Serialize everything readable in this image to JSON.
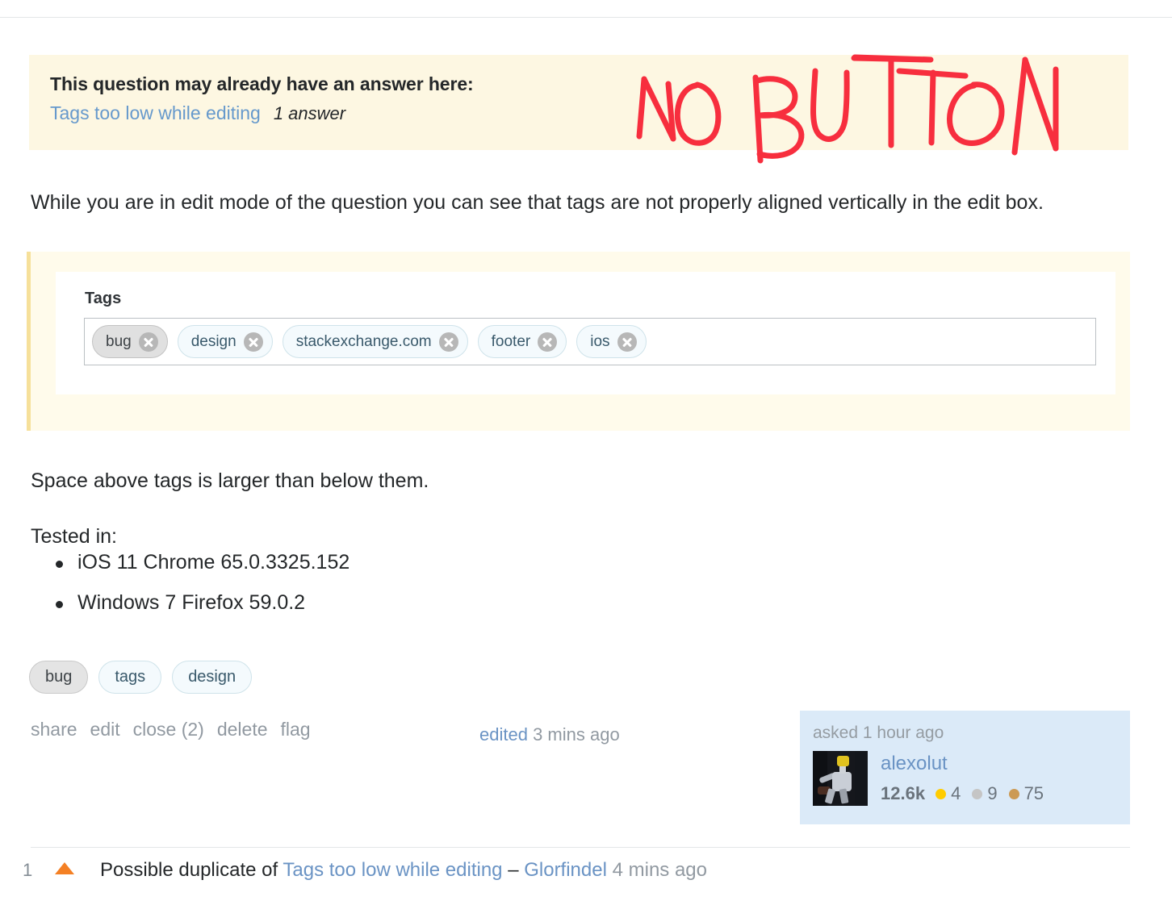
{
  "duplicate_banner": {
    "title": "This question may already have an answer here:",
    "link_text": "Tags too low while editing",
    "answer_count": "1 answer",
    "background": "#fdf7e2",
    "link_color": "#6699cc"
  },
  "annotation": {
    "text": "NO BUTTON",
    "color": "#f72e3e",
    "style": "handwritten-marker"
  },
  "post_body": {
    "intro": "While you are in edit mode of the question you can see that tags are not properly aligned vertically in the edit box.",
    "after_quote": "Space above tags is larger than below them.",
    "tested_label": "Tested in:",
    "tested_items": [
      "iOS 11 Chrome 65.0.3325.152",
      "Windows 7 Firefox 59.0.2"
    ]
  },
  "screenshot_quote": {
    "tags_label": "Tags",
    "editor_tags": [
      {
        "name": "bug",
        "focused": true
      },
      {
        "name": "design",
        "focused": false
      },
      {
        "name": "stackexchange.com",
        "focused": false
      },
      {
        "name": "footer",
        "focused": false
      },
      {
        "name": "ios",
        "focused": false
      }
    ],
    "remove_icon": "close-circle-icon",
    "border_color": "#f6e09a",
    "background": "#fffbeb"
  },
  "post_tags": [
    {
      "label": "bug",
      "selected": true
    },
    {
      "label": "tags",
      "selected": false
    },
    {
      "label": "design",
      "selected": false
    }
  ],
  "post_actions": [
    "share",
    "edit",
    "close (2)",
    "delete",
    "flag"
  ],
  "edited_stamp": {
    "link": "edited",
    "time": "3 mins ago"
  },
  "user_card": {
    "action_time": "asked 1 hour ago",
    "username": "alexolut",
    "reputation": "12.6k",
    "avatar_icon": "user-avatar",
    "badges": [
      {
        "type": "gold",
        "count": "4",
        "color": "#ffcc01"
      },
      {
        "type": "silver",
        "count": "9",
        "color": "#c5c5c5"
      },
      {
        "type": "bronze",
        "count": "75",
        "color": "#cc9a54"
      }
    ]
  },
  "comment": {
    "score": "1",
    "vote_icon": "upvote-arrow-icon",
    "prefix": "Possible duplicate of ",
    "link_text": "Tags too low while editing",
    "dash": " – ",
    "author": "Glorfindel",
    "time": " 4 mins ago"
  }
}
